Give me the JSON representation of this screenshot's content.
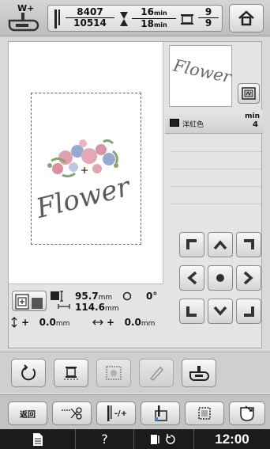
{
  "topbar": {
    "presser_foot_label": "W+",
    "stitch_current": "8407",
    "stitch_total": "10514",
    "time_current": "16",
    "time_total": "18",
    "time_unit": "min",
    "color_current": "9",
    "color_total": "9"
  },
  "thumbnail": {
    "text": "Flower"
  },
  "color_list": {
    "min_label": "min",
    "items": [
      {
        "name": "洋紅色",
        "minutes": "4",
        "swatch": "#1a1a1a"
      }
    ]
  },
  "info": {
    "height": "95.7",
    "width": "114.6",
    "unit": "mm",
    "rotation": "0°",
    "offset_y_sign": "+",
    "offset_y": "0.0",
    "offset_x_sign": "+",
    "offset_x": "0.0"
  },
  "toolbar": {
    "back_label": "返回",
    "needle_label": "-/+"
  },
  "statusbar": {
    "time": "12:00",
    "help": "?"
  },
  "colors": {
    "flower_pink": "#e39aa8",
    "flower_blue": "#8fa7cf",
    "leaf_green": "#7ea36a",
    "text_grey": "#5a5a5a"
  }
}
